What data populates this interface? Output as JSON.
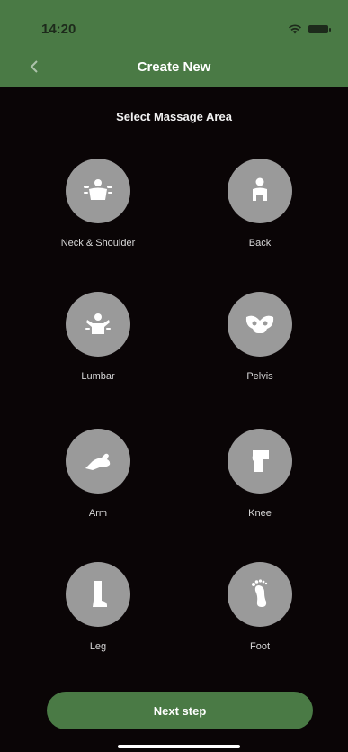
{
  "status_bar": {
    "time": "14:20"
  },
  "nav": {
    "title": "Create New",
    "back_icon": "chevron-left-icon"
  },
  "section_title": "Select Massage Area",
  "areas": [
    {
      "label": "Neck & Shoulder",
      "icon": "neck-shoulder-icon"
    },
    {
      "label": "Back",
      "icon": "back-icon"
    },
    {
      "label": "Lumbar",
      "icon": "lumbar-icon"
    },
    {
      "label": "Pelvis",
      "icon": "pelvis-icon"
    },
    {
      "label": "Arm",
      "icon": "arm-icon"
    },
    {
      "label": "Knee",
      "icon": "knee-icon"
    },
    {
      "label": "Leg",
      "icon": "leg-icon"
    },
    {
      "label": "Foot",
      "icon": "foot-icon"
    }
  ],
  "footer": {
    "next_label": "Next step"
  },
  "colors": {
    "brand_green": "#4a7a45",
    "background": "#0a0506",
    "icon_circle": "#9a9a9a"
  }
}
